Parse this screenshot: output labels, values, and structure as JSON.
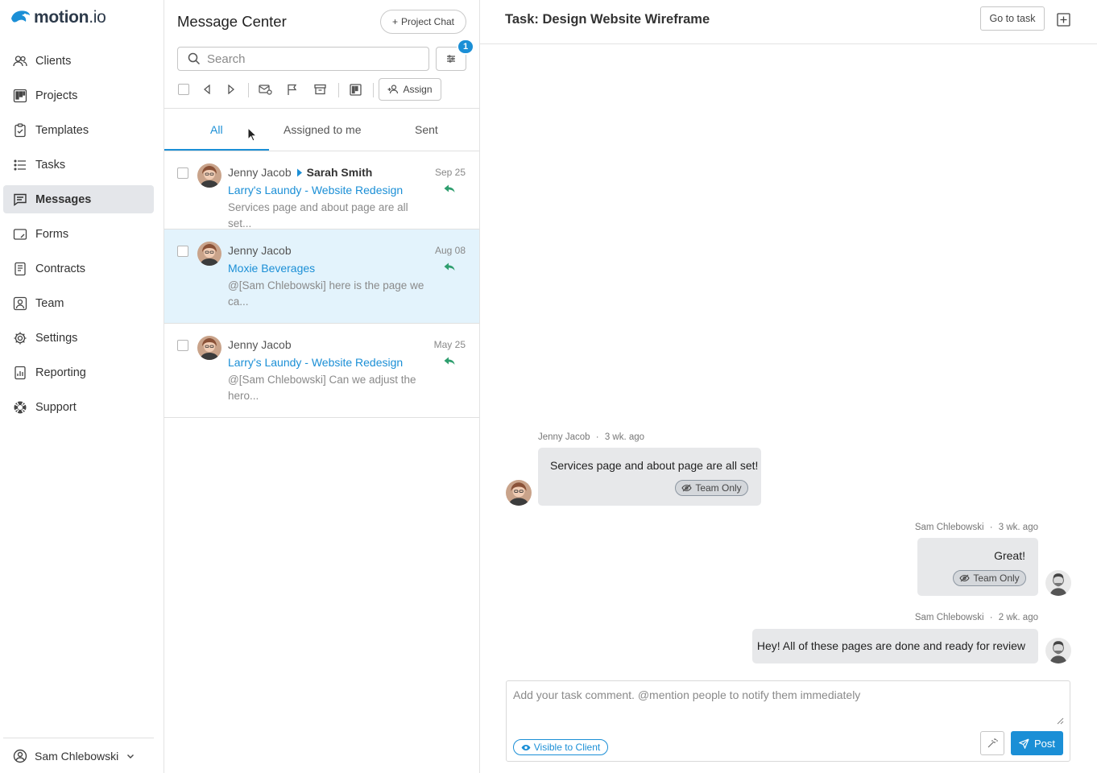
{
  "sidebar": {
    "logo_text": "motion",
    "logo_suffix": ".io",
    "items": [
      {
        "label": "Clients",
        "icon": "users-icon"
      },
      {
        "label": "Projects",
        "icon": "projects-icon"
      },
      {
        "label": "Templates",
        "icon": "templates-icon"
      },
      {
        "label": "Tasks",
        "icon": "tasks-icon"
      },
      {
        "label": "Messages",
        "icon": "messages-icon",
        "active": true
      },
      {
        "label": "Forms",
        "icon": "forms-icon"
      },
      {
        "label": "Contracts",
        "icon": "contracts-icon"
      },
      {
        "label": "Team",
        "icon": "team-icon"
      },
      {
        "label": "Settings",
        "icon": "gear-icon"
      },
      {
        "label": "Reporting",
        "icon": "reporting-icon"
      },
      {
        "label": "Support",
        "icon": "support-icon"
      }
    ],
    "user_name": "Sam Chlebowski"
  },
  "message_center": {
    "title": "Message Center",
    "project_chat_label": "Project Chat",
    "search_placeholder": "Search",
    "filter_badge": "1",
    "assign_label": "Assign",
    "tabs": [
      {
        "label": "All",
        "active": true
      },
      {
        "label": "Assigned to me"
      },
      {
        "label": "Sent"
      }
    ],
    "messages": [
      {
        "from": "Jenny Jacob",
        "to": "Sarah Smith",
        "project": "Larry's Laundy - Website Redesign",
        "preview": "Services page and about page are all set...",
        "date": "Sep 25",
        "selected": false
      },
      {
        "from": "Jenny Jacob",
        "to": "",
        "project": "Moxie Beverages",
        "preview": "@[Sam Chlebowski] here is the page we ca...",
        "date": "Aug 08",
        "selected": true
      },
      {
        "from": "Jenny Jacob",
        "to": "",
        "project": "Larry's Laundy - Website Redesign",
        "preview": "@[Sam Chlebowski] Can we adjust the hero...",
        "date": "May 25",
        "selected": false
      }
    ]
  },
  "task": {
    "title": "Task: Design Website Wireframe",
    "goto_label": "Go to task",
    "comments": [
      {
        "author": "Jenny Jacob",
        "sep": "·",
        "time": "3 wk. ago",
        "text": "Services page and about page are all set!",
        "visibility": "Team Only"
      },
      {
        "author": "Sam Chlebowski",
        "sep": "·",
        "time": "3 wk. ago",
        "text": "Great!",
        "visibility": "Team Only"
      },
      {
        "author": "Sam Chlebowski",
        "sep": "·",
        "time": "2 wk. ago",
        "text": "Hey! All of these pages are done and ready for review",
        "visibility": ""
      }
    ],
    "compose_placeholder": "Add your task comment. @mention people to notify them immediately",
    "visible_label": "Visible to Client",
    "post_label": "Post"
  },
  "colors": {
    "accent": "#1b8fd6",
    "selected_row": "#e3f3fc",
    "reply_arrow": "#2e9e6e",
    "bubble": "#e7e8ea"
  }
}
